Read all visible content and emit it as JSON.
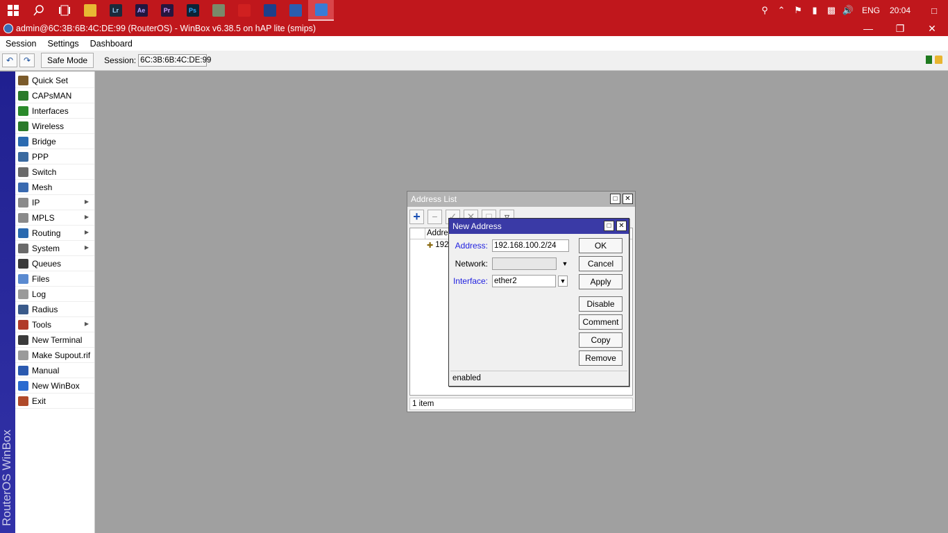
{
  "taskbar": {
    "apps": [
      {
        "name": "file-explorer-icon",
        "label": "",
        "bg": "#e8b833",
        "fg": "#e8b833"
      },
      {
        "name": "lightroom-icon",
        "label": "Lr",
        "bg": "#1b2a3b",
        "fg": "#9ad0f5"
      },
      {
        "name": "after-effects-icon",
        "label": "Ae",
        "bg": "#22163f",
        "fg": "#b4a0ff"
      },
      {
        "name": "premiere-icon",
        "label": "Pr",
        "bg": "#26163f",
        "fg": "#d59cff"
      },
      {
        "name": "photoshop-icon",
        "label": "Ps",
        "bg": "#0c2336",
        "fg": "#31a8ff"
      },
      {
        "name": "app-icon",
        "label": "",
        "bg": "#7a8a6a",
        "fg": "#ddd"
      },
      {
        "name": "red-app-icon",
        "label": "",
        "bg": "#d02020",
        "fg": "#fff"
      },
      {
        "name": "cinema4d-icon",
        "label": "",
        "bg": "#1e3f8a",
        "fg": "#fff"
      },
      {
        "name": "network-app-icon",
        "label": "",
        "bg": "#2a5db0",
        "fg": "#fff"
      },
      {
        "name": "winbox-taskbar-icon",
        "label": "",
        "bg": "#3a7bd5",
        "fg": "#fff"
      }
    ],
    "language": "ENG",
    "clock": "20:04"
  },
  "window": {
    "title": "admin@6C:3B:6B:4C:DE:99 (RouterOS) - WinBox v6.38.5 on hAP lite (smips)"
  },
  "menu": [
    "Session",
    "Settings",
    "Dashboard"
  ],
  "toolbar": {
    "safe_mode": "Safe Mode",
    "session_label": "Session:",
    "session_value": "6C:3B:6B:4C:DE:99"
  },
  "sidebar": {
    "brand": "RouterOS WinBox",
    "items": [
      {
        "label": "Quick Set",
        "icon": "quick-set-icon",
        "sub": false,
        "color": "#7a5a2a"
      },
      {
        "label": "CAPsMAN",
        "icon": "capsman-icon",
        "sub": false,
        "color": "#2a7a2a"
      },
      {
        "label": "Interfaces",
        "icon": "interfaces-icon",
        "sub": false,
        "color": "#2a8a2a"
      },
      {
        "label": "Wireless",
        "icon": "wireless-icon",
        "sub": false,
        "color": "#2a7a2a"
      },
      {
        "label": "Bridge",
        "icon": "bridge-icon",
        "sub": false,
        "color": "#2a6ab0"
      },
      {
        "label": "PPP",
        "icon": "ppp-icon",
        "sub": false,
        "color": "#3a6aa0"
      },
      {
        "label": "Switch",
        "icon": "switch-icon",
        "sub": false,
        "color": "#6a6a6a"
      },
      {
        "label": "Mesh",
        "icon": "mesh-icon",
        "sub": false,
        "color": "#3a6ab0"
      },
      {
        "label": "IP",
        "icon": "ip-icon",
        "sub": true,
        "color": "#8a8a8a"
      },
      {
        "label": "MPLS",
        "icon": "mpls-icon",
        "sub": true,
        "color": "#8a8a8a"
      },
      {
        "label": "Routing",
        "icon": "routing-icon",
        "sub": true,
        "color": "#2a6ab0"
      },
      {
        "label": "System",
        "icon": "system-icon",
        "sub": true,
        "color": "#6a6a6a"
      },
      {
        "label": "Queues",
        "icon": "queues-icon",
        "sub": false,
        "color": "#3a3a3a"
      },
      {
        "label": "Files",
        "icon": "files-icon",
        "sub": false,
        "color": "#5a8ad0"
      },
      {
        "label": "Log",
        "icon": "log-icon",
        "sub": false,
        "color": "#9a9a9a"
      },
      {
        "label": "Radius",
        "icon": "radius-icon",
        "sub": false,
        "color": "#3a5a8a"
      },
      {
        "label": "Tools",
        "icon": "tools-icon",
        "sub": true,
        "color": "#b03a2a"
      },
      {
        "label": "New Terminal",
        "icon": "terminal-icon",
        "sub": false,
        "color": "#3a3a3a"
      },
      {
        "label": "Make Supout.rif",
        "icon": "supout-icon",
        "sub": false,
        "color": "#9a9a9a"
      },
      {
        "label": "Manual",
        "icon": "manual-icon",
        "sub": false,
        "color": "#2a5ab0"
      },
      {
        "label": "New WinBox",
        "icon": "new-winbox-icon",
        "sub": false,
        "color": "#2a6ad0"
      },
      {
        "label": "Exit",
        "icon": "exit-icon",
        "sub": false,
        "color": "#b04a2a"
      }
    ]
  },
  "address_list": {
    "title": "Address List",
    "column": "Address",
    "row": "192",
    "status": "1 item"
  },
  "new_address": {
    "title": "New Address",
    "address_label": "Address:",
    "address_value": "192.168.100.2/24",
    "network_label": "Network:",
    "network_value": "",
    "interface_label": "Interface:",
    "interface_value": "ether2",
    "buttons": {
      "ok": "OK",
      "cancel": "Cancel",
      "apply": "Apply",
      "disable": "Disable",
      "comment": "Comment",
      "copy": "Copy",
      "remove": "Remove"
    },
    "status": "enabled"
  }
}
